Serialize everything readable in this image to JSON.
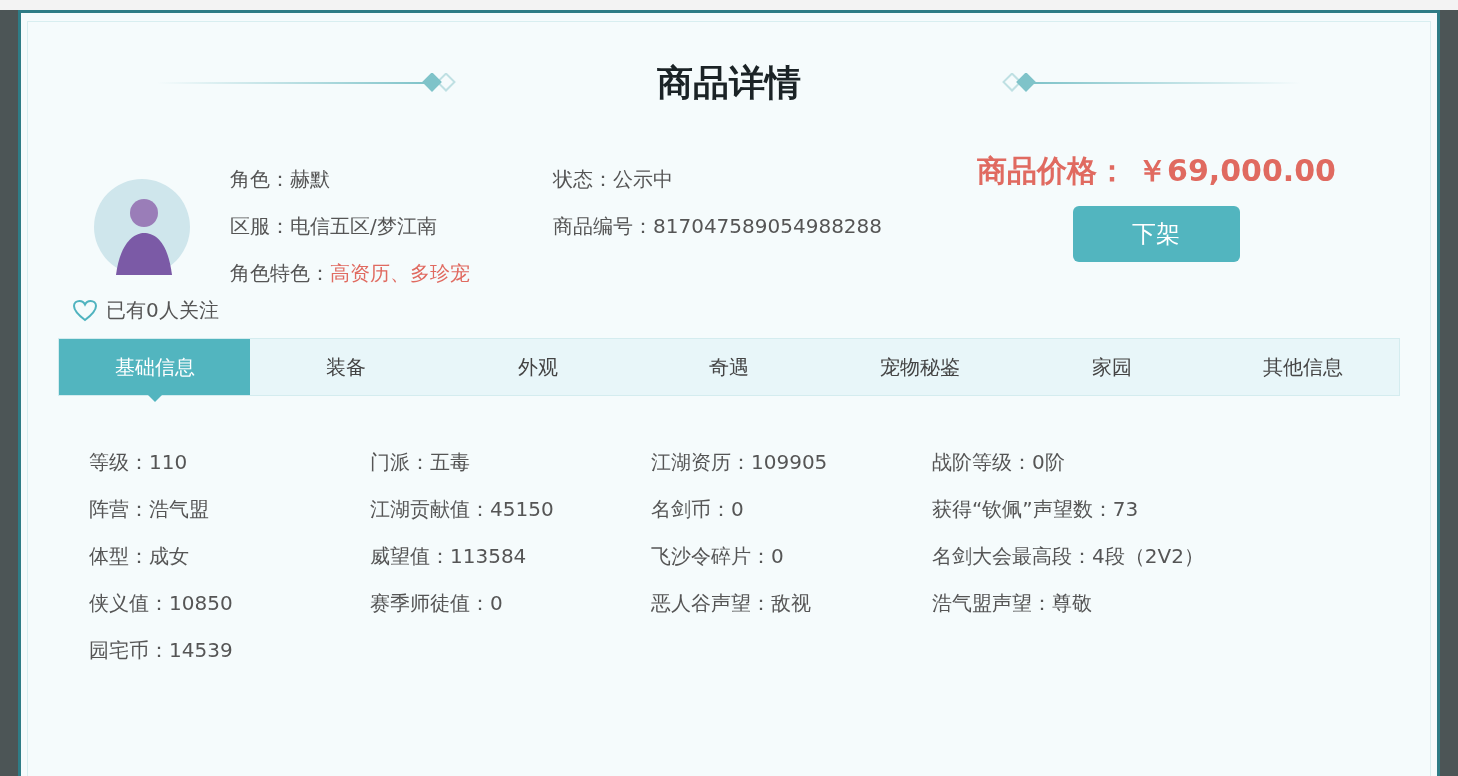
{
  "dialog": {
    "title": "商品详情",
    "profile": {
      "fields": [
        {
          "label": "角色：",
          "value": "赫默",
          "highlight": false
        },
        {
          "label": "状态：",
          "value": "公示中",
          "highlight": false
        },
        {
          "label": "区服：",
          "value": "电信五区/梦江南",
          "highlight": false
        },
        {
          "label": "商品编号：",
          "value": "817047589054988288",
          "highlight": false
        },
        {
          "label": "角色特色：",
          "value": "高资历、多珍宠",
          "highlight": true
        }
      ],
      "followers": "已有0人关注"
    },
    "price": {
      "label": "商品价格：",
      "value": "￥69,000.00"
    },
    "action_button": "下架",
    "tabs": [
      {
        "label": "基础信息",
        "selected": true
      },
      {
        "label": "装备",
        "selected": false
      },
      {
        "label": "外观",
        "selected": false
      },
      {
        "label": "奇遇",
        "selected": false
      },
      {
        "label": "宠物秘鉴",
        "selected": false
      },
      {
        "label": "家园",
        "selected": false
      },
      {
        "label": "其他信息",
        "selected": false
      }
    ],
    "stats": [
      {
        "label": "等级：",
        "value": "110"
      },
      {
        "label": "门派：",
        "value": "五毒"
      },
      {
        "label": "江湖资历：",
        "value": "109905"
      },
      {
        "label": "战阶等级：",
        "value": "0阶"
      },
      {
        "label": "阵营：",
        "value": "浩气盟"
      },
      {
        "label": "江湖贡献值：",
        "value": "45150"
      },
      {
        "label": "名剑币：",
        "value": "0"
      },
      {
        "label": "获得“钦佩”声望数：",
        "value": "73"
      },
      {
        "label": "体型：",
        "value": "成女"
      },
      {
        "label": "威望值：",
        "value": "113584"
      },
      {
        "label": "飞沙令碎片：",
        "value": "0"
      },
      {
        "label": "名剑大会最高段：",
        "value": "4段（2V2）"
      },
      {
        "label": "侠义值：",
        "value": "10850"
      },
      {
        "label": "赛季师徒值：",
        "value": "0"
      },
      {
        "label": "恶人谷声望：",
        "value": "敌视"
      },
      {
        "label": "浩气盟声望：",
        "value": "尊敬"
      },
      {
        "label": "园宅币：",
        "value": "14539"
      }
    ]
  }
}
